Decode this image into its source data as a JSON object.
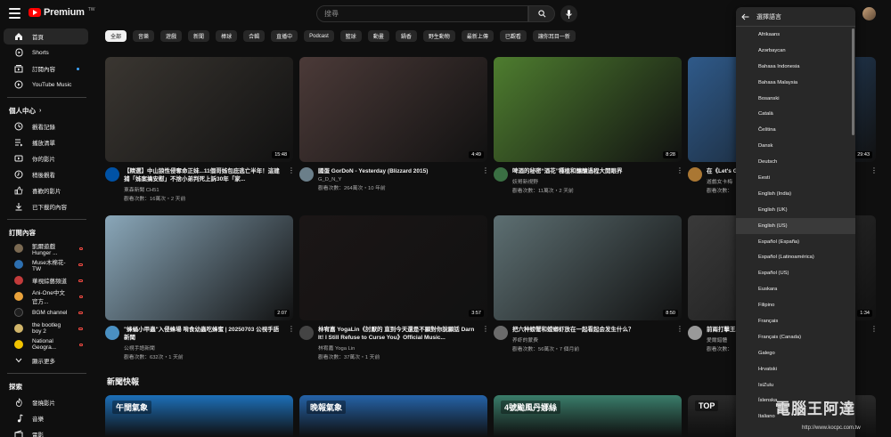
{
  "header": {
    "logo_text": "Premium",
    "logo_region": "TW",
    "search_placeholder": "搜尋"
  },
  "sidebar": {
    "main": [
      {
        "label": "首頁",
        "icon": "home-icon",
        "active": true
      },
      {
        "label": "Shorts",
        "icon": "shorts-icon"
      },
      {
        "label": "訂閱內容",
        "icon": "subscriptions-icon"
      },
      {
        "label": "YouTube Music",
        "icon": "youtube-music-icon"
      }
    ],
    "you_heading": "個人中心",
    "you": [
      {
        "label": "觀看記錄",
        "icon": "history-icon"
      },
      {
        "label": "播放清單",
        "icon": "playlist-icon"
      },
      {
        "label": "你的影片",
        "icon": "your-videos-icon"
      },
      {
        "label": "稍後觀看",
        "icon": "watch-later-icon"
      },
      {
        "label": "喜歡的影片",
        "icon": "like-icon"
      },
      {
        "label": "已下載的內容",
        "icon": "download-icon"
      }
    ],
    "subs_heading": "訂閱內容",
    "subs": [
      {
        "label": "凱爾遊戲Hunger ...",
        "color": "#7b6a52"
      },
      {
        "label": "Muse木棉花-TW",
        "color": "#2d6fb0"
      },
      {
        "label": "華視綜藝頻道",
        "color": "#c23b3b"
      },
      {
        "label": "Ani-One中文官方...",
        "color": "#e9a23b"
      },
      {
        "label": "BGM channel",
        "color": "#1f1f1f"
      },
      {
        "label": "the bootleg boy 2",
        "color": "#d1b56a"
      },
      {
        "label": "National Geogra...",
        "color": "#f2c300"
      }
    ],
    "show_more": "顯示更多",
    "explore_heading": "探索",
    "explore": [
      {
        "label": "發燒影片",
        "icon": "trending-icon"
      },
      {
        "label": "音樂",
        "icon": "music-icon"
      },
      {
        "label": "電影",
        "icon": "movies-icon"
      }
    ]
  },
  "chips": [
    "全部",
    "音樂",
    "遊戲",
    "新聞",
    "棒球",
    "合輯",
    "直播中",
    "Podcast",
    "籃球",
    "動畫",
    "鍋香",
    "野生動物",
    "最新上傳",
    "已觀看",
    "讓你耳目一新"
  ],
  "videos": [
    {
      "title": "【精選】中山狼性侵奪命正妹...11個哥姊包庇逃亡半年！這建捕「姊案擒安慰」不捨小弟判死上訴30年「家...",
      "channel": "東森新聞 CH51",
      "stats": "觀看次數：16萬次・2 天前",
      "duration": "15:48",
      "thumb": "#3a3631",
      "avatar": "#0052a5"
    },
    {
      "title": "國蛋 GorDoN - Yesterday (Blizzard 2015)",
      "channel": "G_D_N_Y",
      "stats": "觀看次數：264萬次・10 年前",
      "duration": "4:49",
      "thumb": "#4b3a38",
      "avatar": "#6b7f8a"
    },
    {
      "title": "啤酒的秘密“酒花”種植和釀釀過程大開眼界",
      "channel": "妖哥新視野",
      "stats": "觀看次數：11萬次・2 天前",
      "duration": "8:28",
      "thumb": "#4e7d2f",
      "avatar": "#3a6f43"
    },
    {
      "title": "在《Let's G...",
      "channel": "遊戲女卡梅",
      "stats": "觀看次數：",
      "duration": "29:43",
      "thumb": "#2f5a8a",
      "avatar": "#aa7733"
    },
    {
      "title": "\"蜂蛹小甲蟲\"入侵蜂場 啃食幼蟲吃蜂蜜 | 20250703 公視手語新聞",
      "channel": "公視手語新聞",
      "stats": "觀看次數：632次・1 天前",
      "duration": "2:07",
      "thumb": "#8aa7b9",
      "avatar": "#4a90c2"
    },
    {
      "title": "林宥嘉 YogaLin《討厭的 直到今天還是不願對你說願話 Darn It! I Still Refuse to Curse You》Official Music...",
      "channel": "林宥嘉 Yoga Lin",
      "stats": "觀看次數：37萬次・1 天前",
      "duration": "3:57",
      "thumb": "#1b1616",
      "avatar": "#444444"
    },
    {
      "title": "把六种螃蟹和螳螂虾放在一起看起会发生什么？",
      "channel": "养虾的蒙费",
      "stats": "觀看次數：56萬次・7 個月前",
      "duration": "8:50",
      "thumb": "#5d6f72",
      "avatar": "#6b6b6b"
    },
    {
      "title": "前兩打擊王...MLB天...",
      "channel": "愛爾錯體",
      "stats": "觀看次數：",
      "duration": "1:34",
      "thumb": "#3a3a3a",
      "avatar": "#999999"
    }
  ],
  "section": {
    "news_title": "新聞快報"
  },
  "news_thumbs": [
    {
      "label": "午間氣象",
      "color": "#1d6fb8"
    },
    {
      "label": "晚報氣象",
      "color": "#2563a8"
    },
    {
      "label": "4號颱風丹娜絲",
      "color": "#3a7d6a"
    },
    {
      "label": "TOP",
      "color": "#2a2a2a"
    }
  ],
  "language_menu": {
    "title": "選擇語言",
    "items": [
      "Afrikaans",
      "Azərbaycan",
      "Bahasa Indonesia",
      "Bahasa Malaysia",
      "Bosanski",
      "Català",
      "Čeština",
      "Dansk",
      "Deutsch",
      "Eesti",
      "English (India)",
      "English (UK)",
      "English (US)",
      "Español (España)",
      "Español (Latinoamérica)",
      "Español (US)",
      "Euskara",
      "Filipino",
      "Français",
      "Français (Canada)",
      "Galego",
      "Hrvatski",
      "IsiZulu",
      "Íslenska",
      "Italiano"
    ],
    "hovered": "English (US)"
  },
  "watermark": {
    "text": "電腦王阿達",
    "url": "http://www.kocpc.com.tw"
  }
}
